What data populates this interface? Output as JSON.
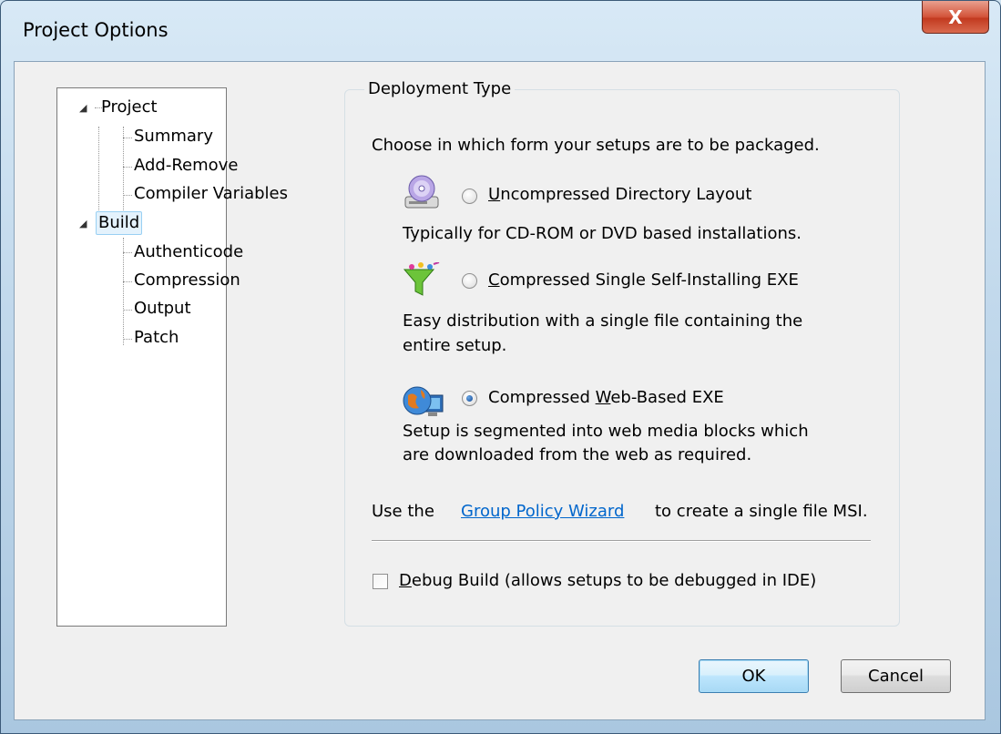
{
  "window": {
    "title": "Project Options",
    "close_label": "X"
  },
  "tree": {
    "project": "Project",
    "summary": "Summary",
    "add_remove": "Add-Remove",
    "compiler_variables": "Compiler Variables",
    "build": "Build",
    "authenticode": "Authenticode",
    "compression": "Compression",
    "output": "Output",
    "patch": "Patch"
  },
  "deployment": {
    "legend": "Deployment Type",
    "intro": "Choose in which form your setups are to be packaged.",
    "options": [
      {
        "accel": "U",
        "label_rest": "ncompressed Directory Layout",
        "desc": [
          "Typically for CD-ROM or DVD based installations."
        ],
        "checked": false,
        "icon": "cd-drive-icon"
      },
      {
        "accel": "C",
        "label_rest": "ompressed Single Self-Installing EXE",
        "desc": [
          "Easy distribution with a single file containing the",
          "entire setup."
        ],
        "checked": false,
        "icon": "funnel-icon"
      },
      {
        "label_pre": "Compressed ",
        "accel": "W",
        "label_rest": "eb-Based EXE",
        "desc": [
          "Setup is segmented into web media blocks which",
          "are downloaded from the web as required."
        ],
        "checked": true,
        "icon": "globe-computer-icon"
      }
    ],
    "gp_pre": "Use the",
    "gp_link": "Group Policy Wizard",
    "gp_post": "to create a single file MSI.",
    "debug_accel": "D",
    "debug_rest": "ebug Build (allows setups to be debugged in IDE)",
    "debug_checked": false
  },
  "buttons": {
    "ok": "OK",
    "cancel": "Cancel"
  },
  "colors": {
    "link": "#0066cc",
    "selection": "#e4f2fc",
    "close": "#c23a20"
  }
}
